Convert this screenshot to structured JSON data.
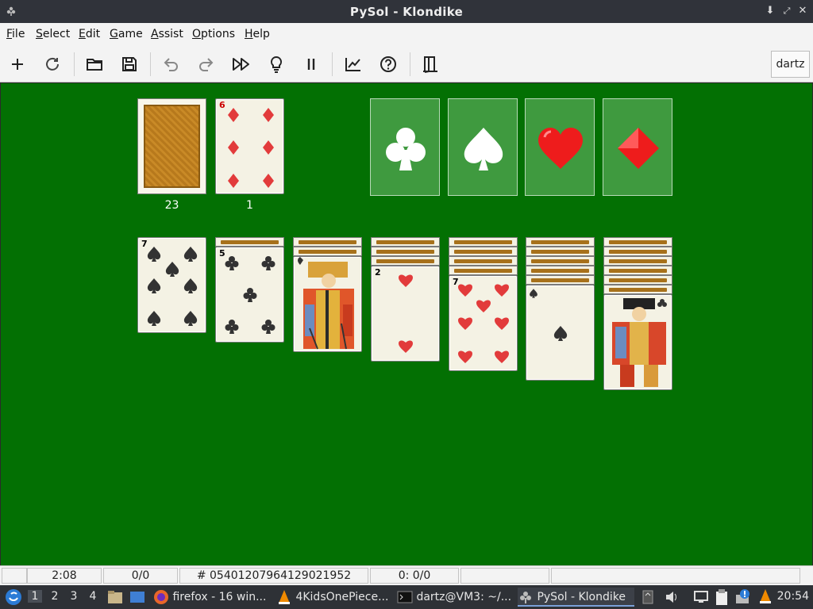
{
  "window": {
    "title": "PySol - Klondike"
  },
  "menu": [
    {
      "u": "F",
      "rest": "ile"
    },
    {
      "u": "S",
      "rest": "elect"
    },
    {
      "u": "E",
      "rest": "dit"
    },
    {
      "u": "G",
      "rest": "ame"
    },
    {
      "u": "A",
      "rest": "ssist"
    },
    {
      "u": "O",
      "rest": "ptions"
    },
    {
      "u": "H",
      "rest": "elp"
    }
  ],
  "toolbar": {
    "player": "dartz"
  },
  "stock": {
    "count": "23"
  },
  "waste": {
    "count": "1",
    "card": {
      "rank": "6",
      "suit": "diamonds"
    }
  },
  "foundations": [
    "clubs",
    "spades",
    "hearts",
    "diamonds"
  ],
  "tableau": [
    {
      "hidden": 0,
      "top": {
        "rank": "7",
        "suit": "spades"
      }
    },
    {
      "hidden": 1,
      "top": {
        "rank": "5",
        "suit": "clubs"
      }
    },
    {
      "hidden": 2,
      "top": {
        "rank": "K",
        "suit": "spades"
      }
    },
    {
      "hidden": 3,
      "top": {
        "rank": "2",
        "suit": "hearts"
      }
    },
    {
      "hidden": 4,
      "top": {
        "rank": "7",
        "suit": "hearts"
      }
    },
    {
      "hidden": 5,
      "top": {
        "rank": "A",
        "suit": "spades"
      }
    },
    {
      "hidden": 6,
      "top": {
        "rank": "J",
        "suit": "clubs"
      }
    }
  ],
  "status": {
    "time": "2:08",
    "moves": "0/0",
    "seed": "# 05401207964129021952",
    "score": "0: 0/0"
  },
  "taskbar": {
    "workspaces": [
      "1",
      "2",
      "3",
      "4"
    ],
    "tasks": [
      "firefox - 16 win...",
      "4KidsOnePiece...",
      "dartz@VM3: ~/...",
      "PySol - Klondike"
    ],
    "clock": "20:54"
  },
  "colors": {
    "felt": "#037003",
    "foundation": "#3f9a3f",
    "card": "#f4f2e4",
    "red_suit": "#e23b3b",
    "black_suit": "#333333"
  }
}
